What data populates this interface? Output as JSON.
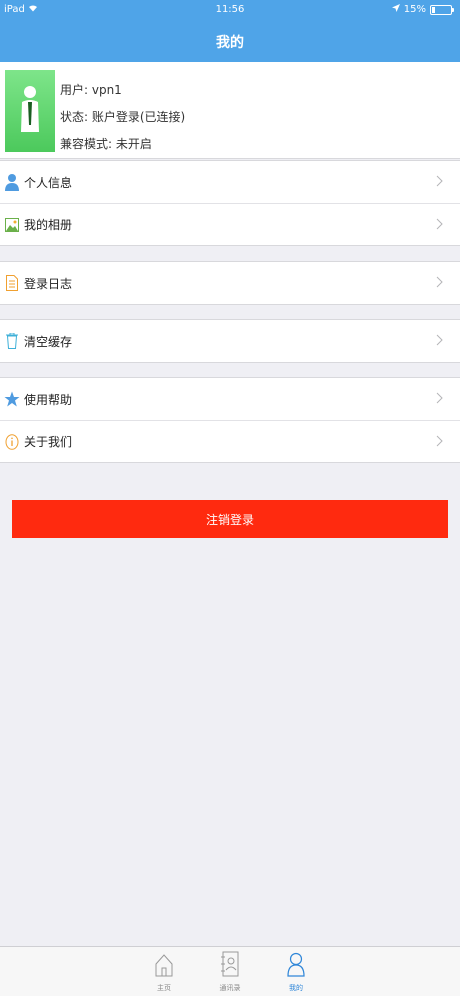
{
  "status": {
    "device": "iPad",
    "time": "11:56",
    "battery": "15%"
  },
  "nav": {
    "title": "我的"
  },
  "profile": {
    "user": "用户: vpn1",
    "state": "状态: 账户登录(已连接)",
    "compat": "兼容模式: 未开启"
  },
  "menu": {
    "personal_info": "个人信息",
    "album": "我的相册",
    "login_log": "登录日志",
    "clear_cache": "清空缓存",
    "help": "使用帮助",
    "about": "关于我们"
  },
  "logout_label": "注销登录",
  "tabs": {
    "home": "主页",
    "contacts": "通讯录",
    "mine": "我的"
  },
  "colors": {
    "nav": "#4fa4e8",
    "logout": "#ff2a0f",
    "active_tab": "#2f86d8",
    "background": "#efeff4"
  }
}
